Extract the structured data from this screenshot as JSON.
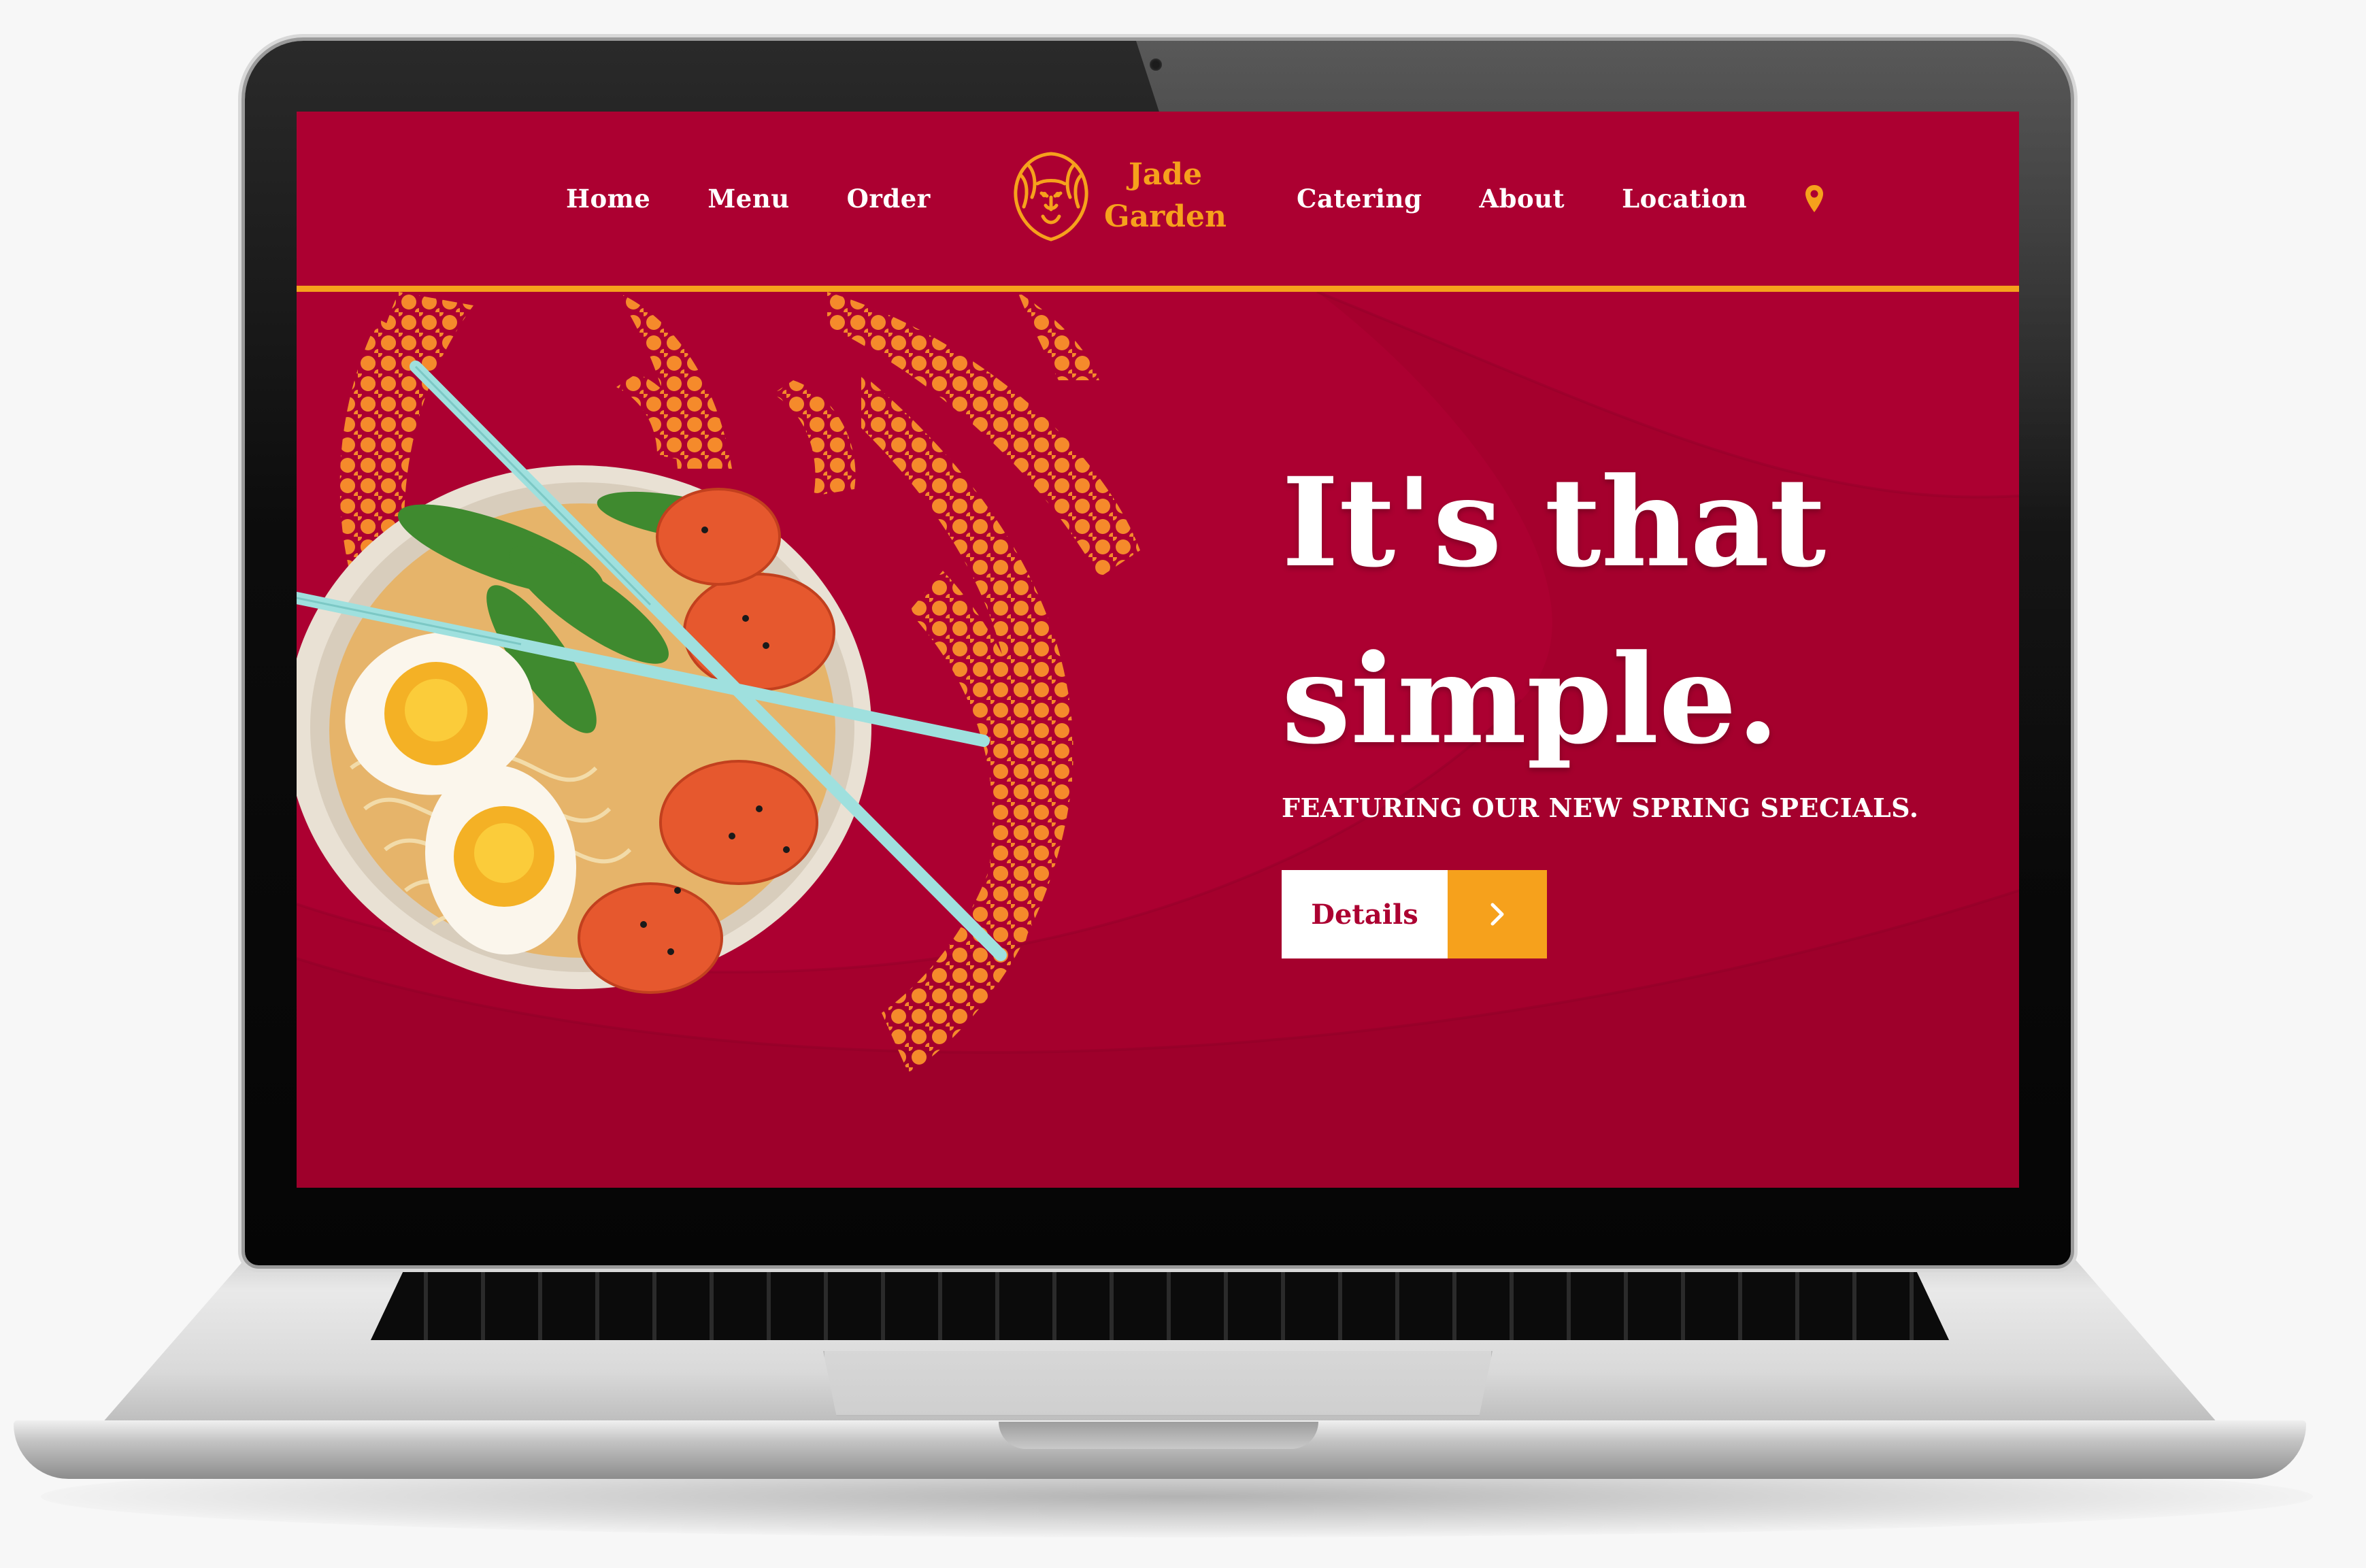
{
  "nav": {
    "left": [
      "Home",
      "Menu",
      "Order"
    ],
    "right": [
      "Catering",
      "About",
      "Location"
    ],
    "location_icon": "map-pin-icon"
  },
  "brand": {
    "name_line1": "Jade",
    "name_line2": "Garden",
    "logo_icon": "lion-head-icon"
  },
  "hero": {
    "headline_line1": "It's that",
    "headline_line2": "simple.",
    "subheadline": "FEATURING OUR NEW SPRING SPECIALS.",
    "cta_label": "Details",
    "cta_icon": "chevron-right-icon"
  },
  "colors": {
    "primary": "#ac0031",
    "accent": "#f6a11c",
    "text": "#ffffff"
  }
}
